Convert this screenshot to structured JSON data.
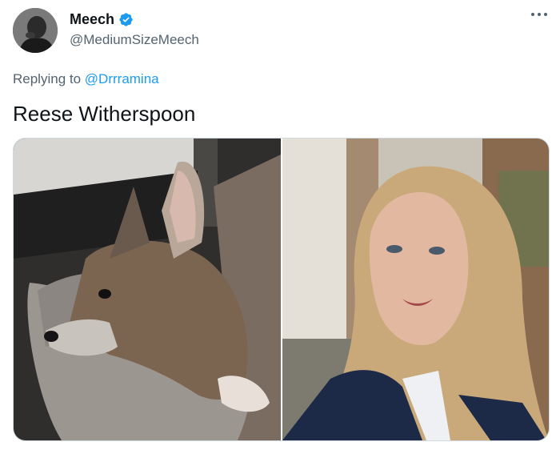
{
  "tweet": {
    "author": {
      "display_name": "Meech",
      "handle": "@MediumSizeMeech",
      "verified": true,
      "avatar_icon": "avatar-photo"
    },
    "more_icon": "more-options-icon",
    "reply": {
      "prefix": "Replying to",
      "mention": "@Drrramina"
    },
    "text": "Reese Witherspoon",
    "media": [
      {
        "description_icon": "dog-photo"
      },
      {
        "description_icon": "woman-photo"
      }
    ]
  },
  "colors": {
    "accent": "#1d9bf0",
    "secondary_text": "#536471",
    "primary_text": "#0f1419",
    "border": "#cfd9de"
  }
}
